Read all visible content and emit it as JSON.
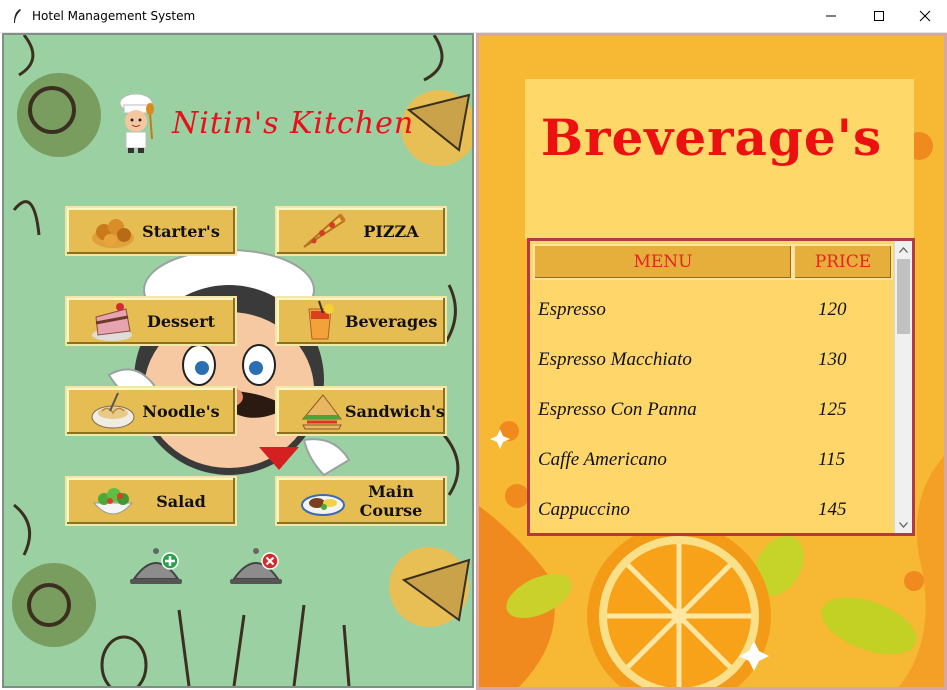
{
  "window": {
    "title": "Hotel Management System",
    "minimize_icon": "minimize-icon",
    "maximize_icon": "maximize-icon",
    "close_icon": "close-icon"
  },
  "left": {
    "brand": "Nitin's Kitchen",
    "menu_buttons": [
      {
        "label": "Starter's",
        "icon": "starter-food-icon"
      },
      {
        "label": "PIZZA",
        "icon": "pizza-slice-icon"
      },
      {
        "label": "Dessert",
        "icon": "cake-icon"
      },
      {
        "label": "Beverages",
        "icon": "drink-glass-icon"
      },
      {
        "label": "Noodle's",
        "icon": "noodle-bowl-icon"
      },
      {
        "label": "Sandwich's",
        "icon": "sandwich-icon"
      },
      {
        "label": "Salad",
        "icon": "salad-bowl-icon"
      },
      {
        "label": "Main Course",
        "icon": "main-course-plate-icon"
      }
    ],
    "action_icons": [
      "add-order-cloche-icon",
      "remove-order-cloche-icon"
    ],
    "colors": {
      "background": "#9bd1a2",
      "button": "#e6bd52",
      "brand": "#e8101a"
    }
  },
  "right": {
    "title": "Breverage's",
    "table": {
      "headers": [
        "MENU",
        "PRICE"
      ],
      "rows": [
        {
          "item": "Espresso",
          "price": "120"
        },
        {
          "item": "Espresso Macchiato",
          "price": "130"
        },
        {
          "item": "Espresso Con Panna",
          "price": "125"
        },
        {
          "item": "Caffe Americano",
          "price": "115"
        },
        {
          "item": "Cappuccino",
          "price": "145"
        }
      ]
    },
    "colors": {
      "background": "#f7b833",
      "card": "#ffd86a",
      "title": "#ec1010",
      "header": "#e6ae3b"
    }
  }
}
